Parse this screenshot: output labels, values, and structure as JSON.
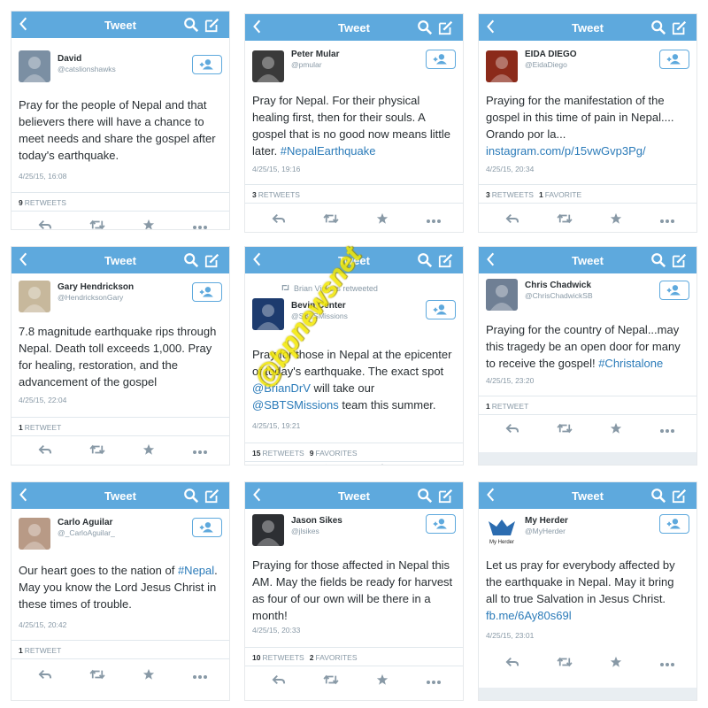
{
  "header": {
    "title": "Tweet"
  },
  "colors": {
    "header_bg": "#5ea9dd",
    "link": "#2b7bb9",
    "watermark": "#f3e800"
  },
  "watermark_text": "@bpnewsnet",
  "panels": [
    {
      "retweeted_by": "",
      "name": "David",
      "handle": "@catslionshawks",
      "text": [
        {
          "t": "Pray for the people of Nepal and that believers there will have a chance to meet needs and share the gospel after today's earthquake.",
          "link": false
        }
      ],
      "timestamp": "4/25/15, 16:08",
      "retweets": "9",
      "retweets_label": "RETWEETS",
      "favorites": "",
      "favorites_label": ""
    },
    {
      "retweeted_by": "",
      "name": "Peter Mular",
      "handle": "@pmular",
      "text": [
        {
          "t": "Pray for Nepal. For their physical healing first, then for their souls. A gospel that is no good now means little later. ",
          "link": false
        },
        {
          "t": "#NepalEarthquake",
          "link": true
        }
      ],
      "timestamp": "4/25/15, 19:16",
      "retweets": "3",
      "retweets_label": "RETWEETS",
      "favorites": "",
      "favorites_label": ""
    },
    {
      "retweeted_by": "",
      "name": "EIDA DIEGO",
      "handle": "@EidaDiego",
      "text": [
        {
          "t": "Praying for the manifestation of the gospel in this time of pain in Nepal.... Orando por la... ",
          "link": false
        },
        {
          "t": "instagram.com/p/15vwGvp3Pg/",
          "link": true
        }
      ],
      "timestamp": "4/25/15, 20:34",
      "retweets": "3",
      "retweets_label": "RETWEETS",
      "favorites": "1",
      "favorites_label": "FAVORITE"
    },
    {
      "retweeted_by": "",
      "name": "Gary Hendrickson",
      "handle": "@HendricksonGary",
      "text": [
        {
          "t": "7.8 magnitude earthquake rips through Nepal. Death toll exceeds 1,000. Pray for healing, restoration, and the advancement of the gospel",
          "link": false
        }
      ],
      "timestamp": "4/25/15, 22:04",
      "retweets": "1",
      "retweets_label": "RETWEET",
      "favorites": "",
      "favorites_label": ""
    },
    {
      "retweeted_by": "Brian Vickers retweeted",
      "name": "Bevin Center",
      "handle": "@SBTSMissions",
      "text": [
        {
          "t": "Pray for those in Nepal at the epicenter of today's earthquake. The exact spot ",
          "link": false
        },
        {
          "t": "@BrianDrV",
          "link": true
        },
        {
          "t": " will take our ",
          "link": false
        },
        {
          "t": "@SBTSMissions",
          "link": true
        },
        {
          "t": " team this summer.",
          "link": false
        }
      ],
      "timestamp": "4/25/15, 19:21",
      "retweets": "15",
      "retweets_label": "RETWEETS",
      "favorites": "9",
      "favorites_label": "FAVORITES"
    },
    {
      "retweeted_by": "",
      "name": "Chris Chadwick",
      "handle": "@ChrisChadwickSB",
      "text": [
        {
          "t": "Praying for the country of Nepal...may this tragedy be an open door for many to receive the gospel! ",
          "link": false
        },
        {
          "t": "#Christalone",
          "link": true
        }
      ],
      "timestamp": "4/25/15, 23:20",
      "retweets": "1",
      "retweets_label": "RETWEET",
      "favorites": "",
      "favorites_label": ""
    },
    {
      "retweeted_by": "",
      "name": "Carlo Aguilar",
      "handle": "@_CarloAguilar_",
      "text": [
        {
          "t": "Our heart goes to the nation of ",
          "link": false
        },
        {
          "t": "#Nepal",
          "link": true
        },
        {
          "t": ". May you know the Lord Jesus Christ in these times of trouble.",
          "link": false
        }
      ],
      "timestamp": "4/25/15, 20:42",
      "retweets": "1",
      "retweets_label": "RETWEET",
      "favorites": "",
      "favorites_label": ""
    },
    {
      "retweeted_by": "",
      "name": "Jason Sikes",
      "handle": "@jlsikes",
      "text": [
        {
          "t": "Praying for those affected in Nepal this AM. May the fields be ready for harvest as four of our own will be there in a month!",
          "link": false
        }
      ],
      "timestamp": "4/25/15, 20:33",
      "retweets": "10",
      "retweets_label": "RETWEETS",
      "favorites": "2",
      "favorites_label": "FAVORITES"
    },
    {
      "retweeted_by": "",
      "name": "My Herder",
      "handle": "@MyHerder",
      "avatar_text": "My Herder",
      "text": [
        {
          "t": "Let us pray for everybody affected by the earthquake in Nepal. May it bring all to true Salvation in Jesus Christ. ",
          "link": false
        },
        {
          "t": "fb.me/6Ay80s69l",
          "link": true
        }
      ],
      "timestamp": "4/25/15, 23:01",
      "retweets": "",
      "retweets_label": "",
      "favorites": "",
      "favorites_label": ""
    }
  ]
}
